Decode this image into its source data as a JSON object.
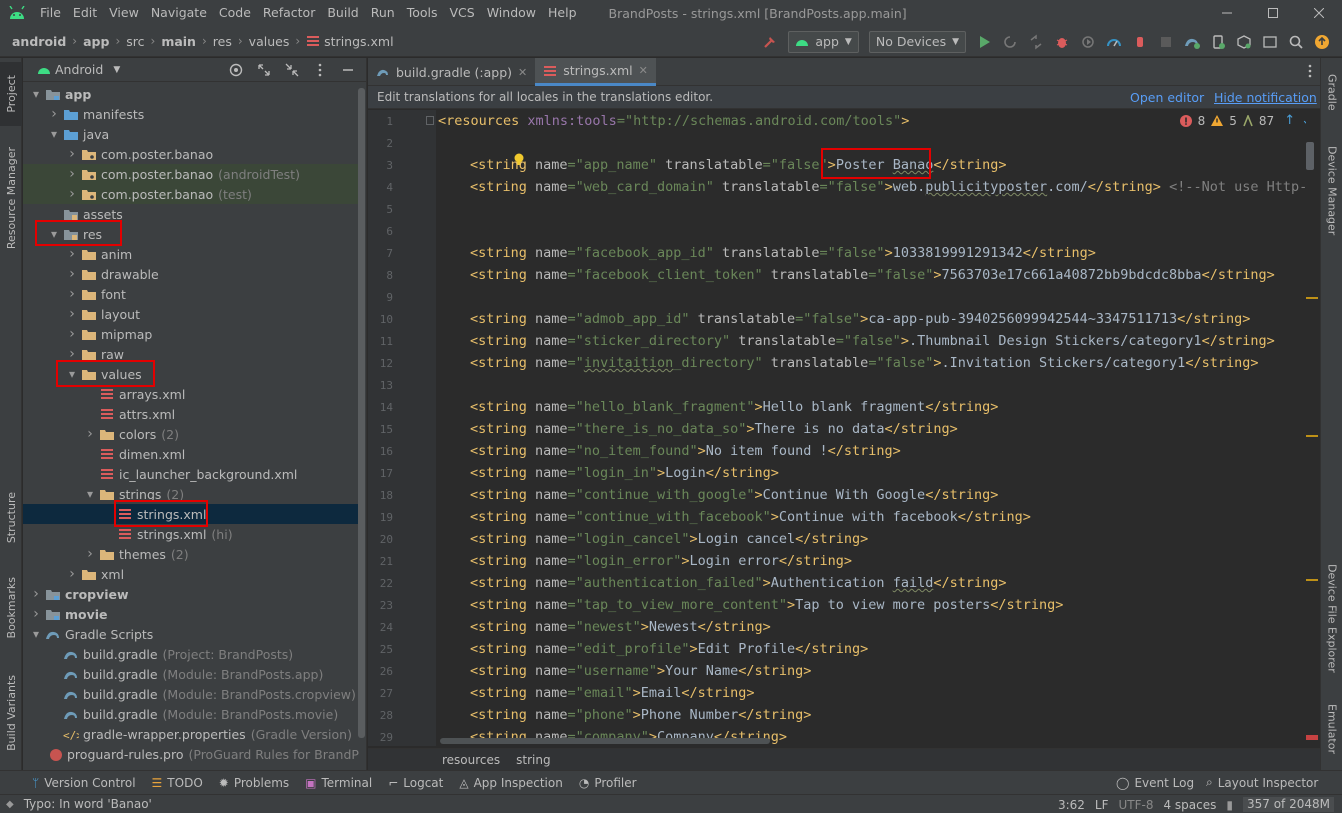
{
  "window": {
    "title": "BrandPosts - strings.xml [BrandPosts.app.main]",
    "menu": [
      "File",
      "Edit",
      "View",
      "Navigate",
      "Code",
      "Refactor",
      "Build",
      "Run",
      "Tools",
      "VCS",
      "Window",
      "Help"
    ]
  },
  "breadcrumb": [
    "android",
    "app",
    "src",
    "main",
    "res",
    "values",
    "strings.xml"
  ],
  "toolbar": {
    "run_config": "app",
    "device": "No Devices"
  },
  "project_panel": {
    "view_mode": "Android",
    "tree": [
      {
        "label": "app",
        "hint": "",
        "icon": "module-folder-icon",
        "indent": 0,
        "arrow": "down",
        "bold": true
      },
      {
        "label": "manifests",
        "hint": "",
        "icon": "folder-blue-icon",
        "indent": 1,
        "arrow": "right"
      },
      {
        "label": "java",
        "hint": "",
        "icon": "folder-blue-icon",
        "indent": 1,
        "arrow": "down"
      },
      {
        "label": "com.poster.banao",
        "hint": "",
        "icon": "package-icon",
        "indent": 2,
        "arrow": "right"
      },
      {
        "label": "com.poster.banao",
        "hint": "(androidTest)",
        "icon": "package-icon",
        "indent": 2,
        "arrow": "right",
        "green": true
      },
      {
        "label": "com.poster.banao",
        "hint": "(test)",
        "icon": "package-icon",
        "indent": 2,
        "arrow": "right",
        "green": true
      },
      {
        "label": "assets",
        "hint": "",
        "icon": "res-folder-icon",
        "indent": 1,
        "arrow": ""
      },
      {
        "label": "res",
        "hint": "",
        "icon": "res-folder-icon",
        "indent": 1,
        "arrow": "down"
      },
      {
        "label": "anim",
        "hint": "",
        "icon": "folder-icon",
        "indent": 2,
        "arrow": "right"
      },
      {
        "label": "drawable",
        "hint": "",
        "icon": "folder-icon",
        "indent": 2,
        "arrow": "right"
      },
      {
        "label": "font",
        "hint": "",
        "icon": "folder-icon",
        "indent": 2,
        "arrow": "right"
      },
      {
        "label": "layout",
        "hint": "",
        "icon": "folder-icon",
        "indent": 2,
        "arrow": "right"
      },
      {
        "label": "mipmap",
        "hint": "",
        "icon": "folder-icon",
        "indent": 2,
        "arrow": "right"
      },
      {
        "label": "raw",
        "hint": "",
        "icon": "folder-icon",
        "indent": 2,
        "arrow": "right"
      },
      {
        "label": "values",
        "hint": "",
        "icon": "folder-icon",
        "indent": 2,
        "arrow": "down"
      },
      {
        "label": "arrays.xml",
        "hint": "",
        "icon": "xml-values-icon",
        "indent": 3,
        "arrow": ""
      },
      {
        "label": "attrs.xml",
        "hint": "",
        "icon": "xml-values-icon",
        "indent": 3,
        "arrow": ""
      },
      {
        "label": "colors",
        "hint": "(2)",
        "icon": "folder-icon",
        "indent": 3,
        "arrow": "right"
      },
      {
        "label": "dimen.xml",
        "hint": "",
        "icon": "xml-values-icon",
        "indent": 3,
        "arrow": ""
      },
      {
        "label": "ic_launcher_background.xml",
        "hint": "",
        "icon": "xml-values-icon",
        "indent": 3,
        "arrow": ""
      },
      {
        "label": "strings",
        "hint": "(2)",
        "icon": "folder-icon",
        "indent": 3,
        "arrow": "down"
      },
      {
        "label": "strings.xml",
        "hint": "",
        "icon": "xml-values-icon",
        "indent": 4,
        "arrow": "",
        "selected": true
      },
      {
        "label": "strings.xml",
        "hint": "(hi)",
        "icon": "xml-values-icon",
        "indent": 4,
        "arrow": ""
      },
      {
        "label": "themes",
        "hint": "(2)",
        "icon": "folder-icon",
        "indent": 3,
        "arrow": "right"
      },
      {
        "label": "xml",
        "hint": "",
        "icon": "folder-icon",
        "indent": 2,
        "arrow": "right"
      },
      {
        "label": "cropview",
        "hint": "",
        "icon": "module-folder-icon",
        "indent": 0,
        "arrow": "right",
        "bold": true
      },
      {
        "label": "movie",
        "hint": "",
        "icon": "module-folder-icon",
        "indent": 0,
        "arrow": "right",
        "bold": true
      },
      {
        "label": "Gradle Scripts",
        "hint": "",
        "icon": "gradle-icon",
        "indent": 0,
        "arrow": "down"
      },
      {
        "label": "build.gradle",
        "hint": "(Project: BrandPosts)",
        "icon": "gradle-icon",
        "indent": 1,
        "arrow": ""
      },
      {
        "label": "build.gradle",
        "hint": "(Module: BrandPosts.app)",
        "icon": "gradle-icon",
        "indent": 1,
        "arrow": ""
      },
      {
        "label": "build.gradle",
        "hint": "(Module: BrandPosts.cropview)",
        "icon": "gradle-icon",
        "indent": 1,
        "arrow": ""
      },
      {
        "label": "build.gradle",
        "hint": "(Module: BrandPosts.movie)",
        "icon": "gradle-icon",
        "indent": 1,
        "arrow": ""
      },
      {
        "label": "gradle-wrapper.properties",
        "hint": "(Gradle Version)",
        "icon": "properties-icon",
        "indent": 1,
        "arrow": ""
      },
      {
        "label": "proguard-rules.pro",
        "hint": "(ProGuard Rules for BrandPosts.ap",
        "icon": "proguard-icon",
        "indent": 1,
        "arrow": ""
      }
    ]
  },
  "left_stripe": [
    "Project",
    "Resource Manager",
    "Structure",
    "Bookmarks",
    "Build Variants"
  ],
  "right_stripe": [
    "Gradle",
    "Device Manager",
    "Device File Explorer",
    "Emulator"
  ],
  "editor": {
    "tabs": [
      {
        "label": "build.gradle (:app)",
        "active": false
      },
      {
        "label": "strings.xml",
        "active": true
      }
    ],
    "notification": {
      "message": "Edit translations for all locales in the translations editor.",
      "open_editor": "Open editor",
      "hide": "Hide notification"
    },
    "inspections": {
      "errors": "8",
      "warnings": "5",
      "weak": "87"
    },
    "line_numbers": [
      "1",
      "2",
      "3",
      "4",
      "5",
      "6",
      "7",
      "8",
      "9",
      "10",
      "11",
      "12",
      "13",
      "14",
      "15",
      "16",
      "17",
      "18",
      "19",
      "20",
      "21",
      "22",
      "23",
      "24",
      "25",
      "26",
      "27",
      "28",
      "29"
    ],
    "code_lines": [
      [
        {
          "c": "tag",
          "t": "<resources "
        },
        {
          "c": "ns",
          "t": "xmlns:tools"
        },
        {
          "c": "str",
          "t": "=\"http://schemas.android.com/tools\""
        },
        {
          "c": "tag",
          "t": ">"
        }
      ],
      [],
      [
        {
          "c": "tag",
          "t": "<string "
        },
        {
          "c": "attr",
          "t": "name"
        },
        {
          "c": "str",
          "t": "=\"app_name\" "
        },
        {
          "c": "attr",
          "t": "translatable"
        },
        {
          "c": "str",
          "t": "=\"false\""
        },
        {
          "c": "tag",
          "t": ">"
        },
        {
          "c": "txt",
          "t": "Poster "
        },
        {
          "c": "txt sq",
          "t": "Banao"
        },
        {
          "c": "tag",
          "t": "</string>"
        }
      ],
      [
        {
          "c": "tag",
          "t": "<string "
        },
        {
          "c": "attr",
          "t": "name"
        },
        {
          "c": "str",
          "t": "=\"web_card_domain\" "
        },
        {
          "c": "attr",
          "t": "translatable"
        },
        {
          "c": "str",
          "t": "=\"false\""
        },
        {
          "c": "tag",
          "t": ">"
        },
        {
          "c": "txt",
          "t": "web."
        },
        {
          "c": "txt sq",
          "t": "publicityposter"
        },
        {
          "c": "txt",
          "t": ".com/"
        },
        {
          "c": "tag",
          "t": "</string> "
        },
        {
          "c": "cmt",
          "t": "<!--Not use Http-->"
        }
      ],
      [],
      [],
      [
        {
          "c": "tag",
          "t": "<string "
        },
        {
          "c": "attr",
          "t": "name"
        },
        {
          "c": "str",
          "t": "=\"facebook_app_id\" "
        },
        {
          "c": "attr",
          "t": "translatable"
        },
        {
          "c": "str",
          "t": "=\"false\""
        },
        {
          "c": "tag",
          "t": ">"
        },
        {
          "c": "txt",
          "t": "1033819991291342"
        },
        {
          "c": "tag",
          "t": "</string>"
        }
      ],
      [
        {
          "c": "tag",
          "t": "<string "
        },
        {
          "c": "attr",
          "t": "name"
        },
        {
          "c": "str",
          "t": "=\"facebook_client_token\" "
        },
        {
          "c": "attr",
          "t": "translatable"
        },
        {
          "c": "str",
          "t": "=\"false\""
        },
        {
          "c": "tag",
          "t": ">"
        },
        {
          "c": "txt",
          "t": "7563703e17c661a40872bb9bdcdc8bba"
        },
        {
          "c": "tag",
          "t": "</string>"
        }
      ],
      [],
      [
        {
          "c": "tag",
          "t": "<string "
        },
        {
          "c": "attr",
          "t": "name"
        },
        {
          "c": "str",
          "t": "=\"admob_app_id\" "
        },
        {
          "c": "attr",
          "t": "translatable"
        },
        {
          "c": "str",
          "t": "=\"false\""
        },
        {
          "c": "tag",
          "t": ">"
        },
        {
          "c": "txt",
          "t": "ca-app-pub-3940256099942544~3347511713"
        },
        {
          "c": "tag",
          "t": "</string>"
        }
      ],
      [
        {
          "c": "tag",
          "t": "<string "
        },
        {
          "c": "attr",
          "t": "name"
        },
        {
          "c": "str",
          "t": "=\"sticker_directory\" "
        },
        {
          "c": "attr",
          "t": "translatable"
        },
        {
          "c": "str",
          "t": "=\"false\""
        },
        {
          "c": "tag",
          "t": ">"
        },
        {
          "c": "txt",
          "t": ".Thumbnail Design Stickers/category1"
        },
        {
          "c": "tag",
          "t": "</string>"
        }
      ],
      [
        {
          "c": "tag",
          "t": "<string "
        },
        {
          "c": "attr",
          "t": "name"
        },
        {
          "c": "str",
          "t": "=\""
        },
        {
          "c": "str sq",
          "t": "invitaition"
        },
        {
          "c": "str",
          "t": "_directory\" "
        },
        {
          "c": "attr",
          "t": "translatable"
        },
        {
          "c": "str",
          "t": "=\"false\""
        },
        {
          "c": "tag",
          "t": ">"
        },
        {
          "c": "txt",
          "t": ".Invitation Stickers/category1"
        },
        {
          "c": "tag",
          "t": "</string>"
        }
      ],
      [],
      [
        {
          "c": "tag",
          "t": "<string "
        },
        {
          "c": "attr",
          "t": "name"
        },
        {
          "c": "str",
          "t": "=\"hello_blank_fragment\""
        },
        {
          "c": "tag",
          "t": ">"
        },
        {
          "c": "txt",
          "t": "Hello blank fragment"
        },
        {
          "c": "tag",
          "t": "</string>"
        }
      ],
      [
        {
          "c": "tag",
          "t": "<string "
        },
        {
          "c": "attr",
          "t": "name"
        },
        {
          "c": "str",
          "t": "=\"there_is_no_data_so\""
        },
        {
          "c": "tag",
          "t": ">"
        },
        {
          "c": "txt",
          "t": "There is no data"
        },
        {
          "c": "tag",
          "t": "</string>"
        }
      ],
      [
        {
          "c": "tag",
          "t": "<string "
        },
        {
          "c": "attr",
          "t": "name"
        },
        {
          "c": "str",
          "t": "=\"no_item_found\""
        },
        {
          "c": "tag",
          "t": ">"
        },
        {
          "c": "txt",
          "t": "No item found !"
        },
        {
          "c": "tag",
          "t": "</string>"
        }
      ],
      [
        {
          "c": "tag",
          "t": "<string "
        },
        {
          "c": "attr",
          "t": "name"
        },
        {
          "c": "str",
          "t": "=\"login_in\""
        },
        {
          "c": "tag",
          "t": ">"
        },
        {
          "c": "txt",
          "t": "Login"
        },
        {
          "c": "tag",
          "t": "</string>"
        }
      ],
      [
        {
          "c": "tag",
          "t": "<string "
        },
        {
          "c": "attr",
          "t": "name"
        },
        {
          "c": "str",
          "t": "=\"continue_with_google\""
        },
        {
          "c": "tag",
          "t": ">"
        },
        {
          "c": "txt",
          "t": "Continue With Google"
        },
        {
          "c": "tag",
          "t": "</string>"
        }
      ],
      [
        {
          "c": "tag",
          "t": "<string "
        },
        {
          "c": "attr",
          "t": "name"
        },
        {
          "c": "str",
          "t": "=\"continue_with_facebook\""
        },
        {
          "c": "tag",
          "t": ">"
        },
        {
          "c": "txt",
          "t": "Continue with facebook"
        },
        {
          "c": "tag",
          "t": "</string>"
        }
      ],
      [
        {
          "c": "tag",
          "t": "<string "
        },
        {
          "c": "attr",
          "t": "name"
        },
        {
          "c": "str",
          "t": "=\"login_cancel\""
        },
        {
          "c": "tag",
          "t": ">"
        },
        {
          "c": "txt",
          "t": "Login cancel"
        },
        {
          "c": "tag",
          "t": "</string>"
        }
      ],
      [
        {
          "c": "tag",
          "t": "<string "
        },
        {
          "c": "attr",
          "t": "name"
        },
        {
          "c": "str",
          "t": "=\"login_error\""
        },
        {
          "c": "tag",
          "t": ">"
        },
        {
          "c": "txt",
          "t": "Login error"
        },
        {
          "c": "tag",
          "t": "</string>"
        }
      ],
      [
        {
          "c": "tag",
          "t": "<string "
        },
        {
          "c": "attr",
          "t": "name"
        },
        {
          "c": "str",
          "t": "=\"authentication_failed\""
        },
        {
          "c": "tag",
          "t": ">"
        },
        {
          "c": "txt",
          "t": "Authentication "
        },
        {
          "c": "txt sq",
          "t": "faild"
        },
        {
          "c": "tag",
          "t": "</string>"
        }
      ],
      [
        {
          "c": "tag",
          "t": "<string "
        },
        {
          "c": "attr",
          "t": "name"
        },
        {
          "c": "str",
          "t": "=\"tap_to_view_more_content\""
        },
        {
          "c": "tag",
          "t": ">"
        },
        {
          "c": "txt",
          "t": "Tap to view more posters"
        },
        {
          "c": "tag",
          "t": "</string>"
        }
      ],
      [
        {
          "c": "tag",
          "t": "<string "
        },
        {
          "c": "attr",
          "t": "name"
        },
        {
          "c": "str",
          "t": "=\"newest\""
        },
        {
          "c": "tag",
          "t": ">"
        },
        {
          "c": "txt",
          "t": "Newest"
        },
        {
          "c": "tag",
          "t": "</string>"
        }
      ],
      [
        {
          "c": "tag",
          "t": "<string "
        },
        {
          "c": "attr",
          "t": "name"
        },
        {
          "c": "str",
          "t": "=\"edit_profile\""
        },
        {
          "c": "tag",
          "t": ">"
        },
        {
          "c": "txt",
          "t": "Edit Profile"
        },
        {
          "c": "tag",
          "t": "</string>"
        }
      ],
      [
        {
          "c": "tag",
          "t": "<string "
        },
        {
          "c": "attr",
          "t": "name"
        },
        {
          "c": "str",
          "t": "=\"username\""
        },
        {
          "c": "tag",
          "t": ">"
        },
        {
          "c": "txt",
          "t": "Your Name"
        },
        {
          "c": "tag",
          "t": "</string>"
        }
      ],
      [
        {
          "c": "tag",
          "t": "<string "
        },
        {
          "c": "attr",
          "t": "name"
        },
        {
          "c": "str",
          "t": "=\"email\""
        },
        {
          "c": "tag",
          "t": ">"
        },
        {
          "c": "txt",
          "t": "Email"
        },
        {
          "c": "tag",
          "t": "</string>"
        }
      ],
      [
        {
          "c": "tag",
          "t": "<string "
        },
        {
          "c": "attr",
          "t": "name"
        },
        {
          "c": "str",
          "t": "=\"phone\""
        },
        {
          "c": "tag",
          "t": ">"
        },
        {
          "c": "txt",
          "t": "Phone Number"
        },
        {
          "c": "tag",
          "t": "</string>"
        }
      ],
      [
        {
          "c": "tag",
          "t": "<string "
        },
        {
          "c": "attr",
          "t": "name"
        },
        {
          "c": "str",
          "t": "=\"company\""
        },
        {
          "c": "tag",
          "t": ">"
        },
        {
          "c": "txt",
          "t": "Company"
        },
        {
          "c": "tag",
          "t": "</string>"
        }
      ]
    ],
    "footer_breadcrumb": [
      "resources",
      "string"
    ]
  },
  "tool_windows": [
    "Version Control",
    "TODO",
    "Problems",
    "Terminal",
    "Logcat",
    "App Inspection",
    "Profiler",
    "Event Log",
    "Layout Inspector"
  ],
  "status": {
    "message": "Typo: In word 'Banao'",
    "position": "3:62",
    "line_sep": "LF",
    "encoding": "UTF-8",
    "indent": "4 spaces",
    "memory": "357 of 2048M"
  }
}
